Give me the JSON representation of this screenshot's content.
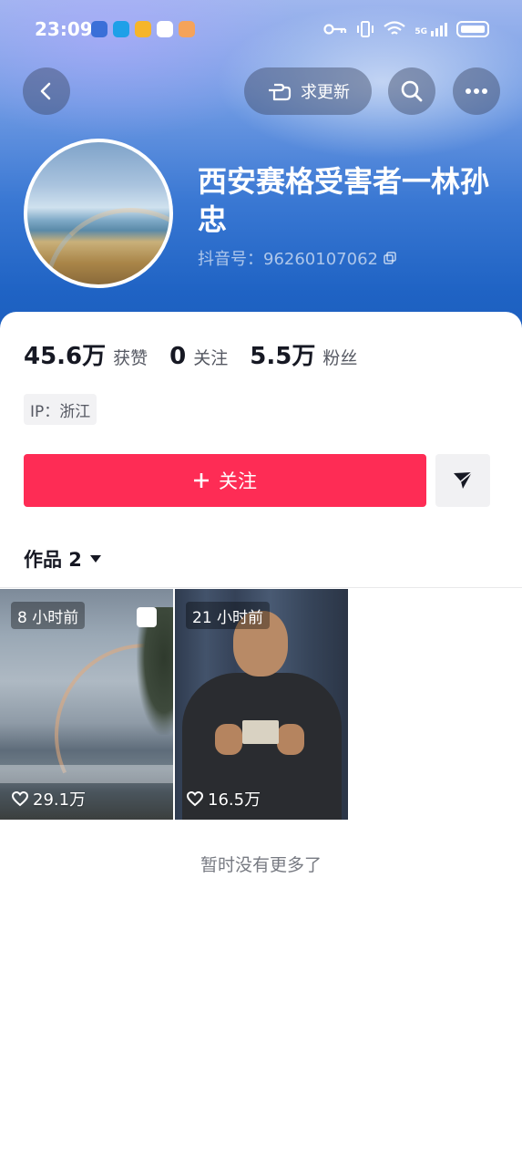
{
  "status_bar": {
    "time": "23:09",
    "network": "5G",
    "app_icons": [
      {
        "name": "app-icon-blue-shield",
        "color": "#3a6fd8"
      },
      {
        "name": "app-icon-book",
        "color": "#1fa0e8"
      },
      {
        "name": "app-icon-weather",
        "color": "#f6b52a"
      },
      {
        "name": "app-icon-music",
        "color": "#ffffff"
      },
      {
        "name": "app-icon-heart",
        "color": "#f5a35a"
      }
    ]
  },
  "header": {
    "request_update_label": "求更新",
    "nickname": "西安赛格受害者一林孙忠",
    "douyin_id": "抖音号：96260107062"
  },
  "stats": {
    "likes_count": "45.6万",
    "likes_label": "获赞",
    "following_count": "0",
    "following_label": "关注",
    "followers_count": "5.5万",
    "followers_label": "粉丝"
  },
  "ip": "IP：浙江",
  "actions": {
    "follow_label": "关注"
  },
  "works": {
    "tab_label": "作品 2",
    "items": [
      {
        "time": "8 小时前",
        "likes": "29.1万"
      },
      {
        "time": "21 小时前",
        "likes": "16.5万"
      }
    ]
  },
  "footer_text": "暂时没有更多了",
  "colors": {
    "accent": "#fe2c55",
    "header_blue": "#1f63c4"
  }
}
